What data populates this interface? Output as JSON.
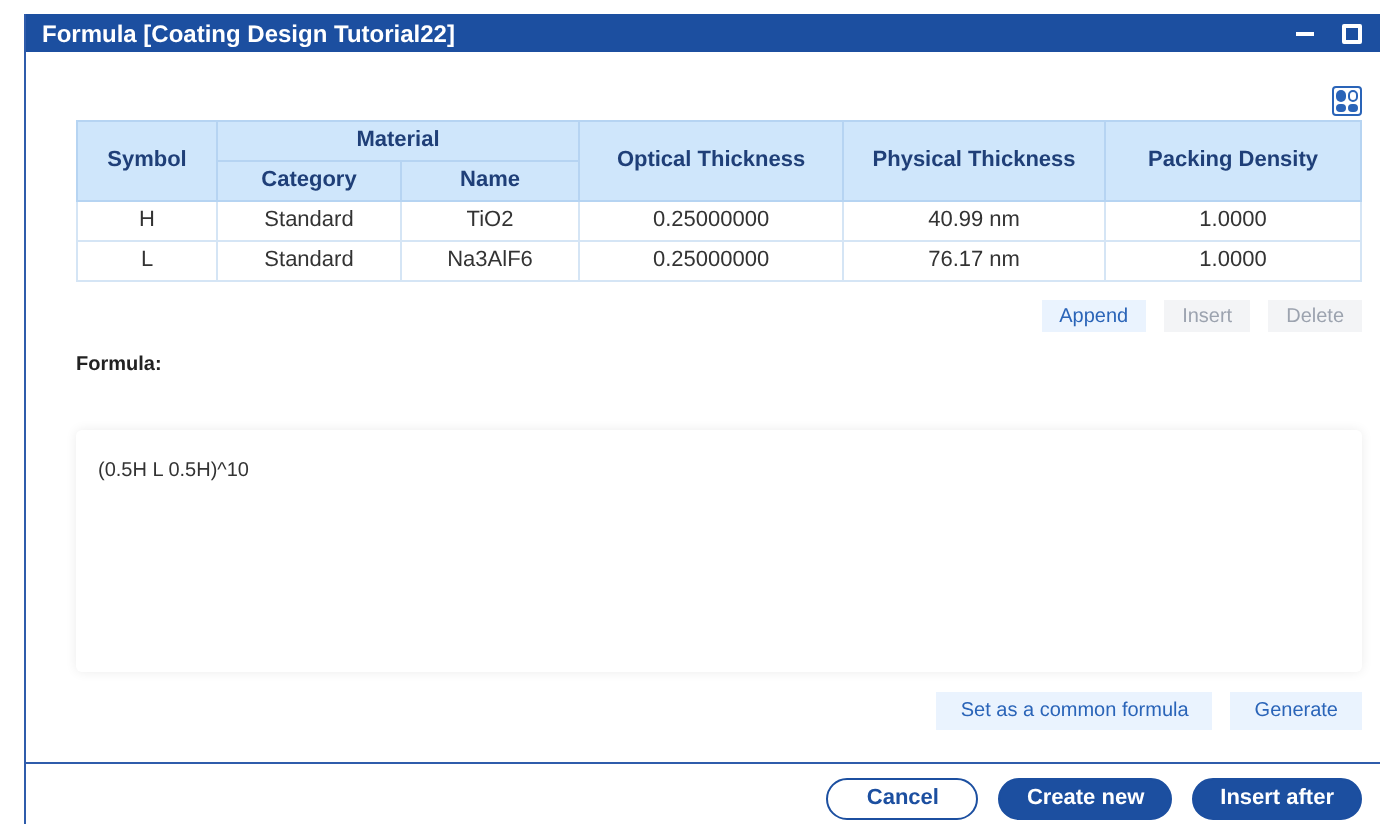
{
  "window": {
    "title": "Formula [Coating Design Tutorial22]"
  },
  "table": {
    "columns": {
      "symbol": "Symbol",
      "material": "Material",
      "category": "Category",
      "name": "Name",
      "optical": "Optical Thickness",
      "physical": "Physical Thickness",
      "packing": "Packing Density"
    },
    "rows": [
      {
        "symbol": "H",
        "category": "Standard",
        "name": "TiO2",
        "optical": "0.25000000",
        "physical": "40.99 nm",
        "packing": "1.0000"
      },
      {
        "symbol": "L",
        "category": "Standard",
        "name": "Na3AlF6",
        "optical": "0.25000000",
        "physical": "76.17 nm",
        "packing": "1.0000"
      }
    ]
  },
  "row_buttons": [
    {
      "label": "Append",
      "disabled": false
    },
    {
      "label": "Insert",
      "disabled": true
    },
    {
      "label": "Delete",
      "disabled": true
    }
  ],
  "formula": {
    "label": "Formula:",
    "value": "(0.5H L 0.5H)^10"
  },
  "formula_buttons": [
    "Set as a common formula",
    "Generate"
  ],
  "footer_buttons": [
    {
      "label": "Cancel",
      "kind": "outline"
    },
    {
      "label": "Create new",
      "kind": "primary"
    },
    {
      "label": "Insert after",
      "kind": "primary"
    }
  ]
}
